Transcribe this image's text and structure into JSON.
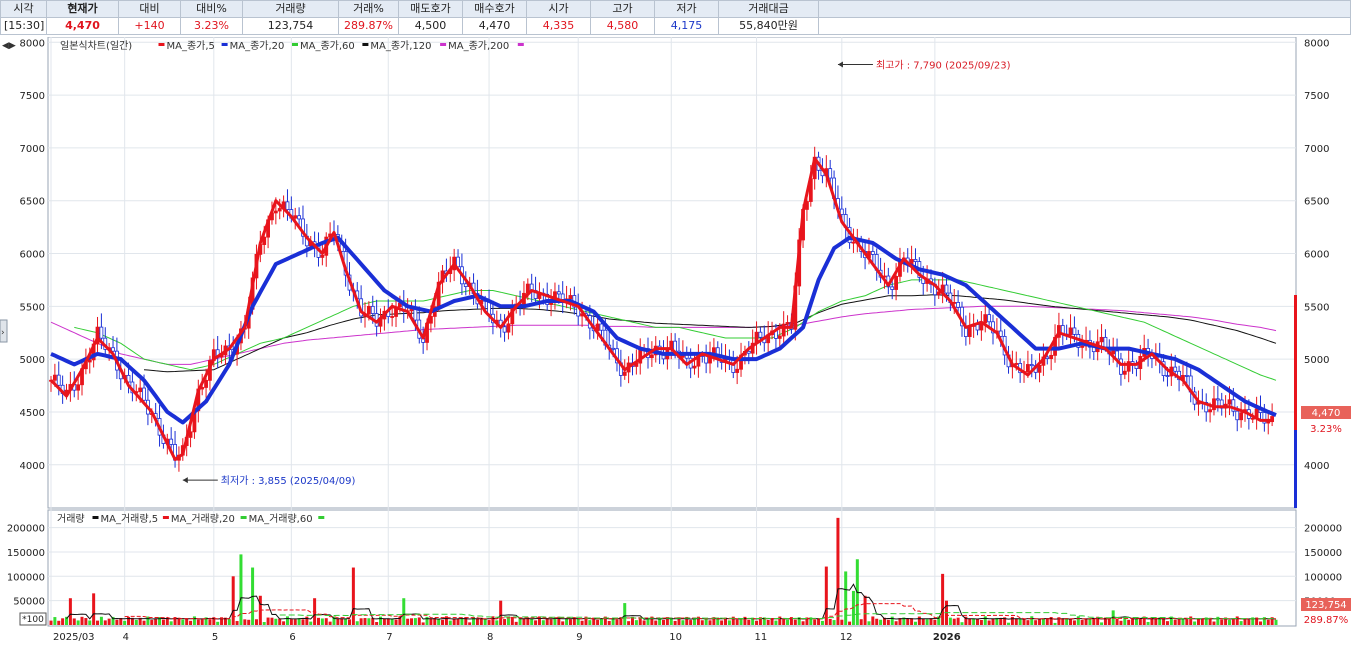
{
  "quote": {
    "headers": [
      "시각",
      "현재가",
      "대비",
      "대비%",
      "거래량",
      "거래%",
      "매도호가",
      "매수호가",
      "시가",
      "고가",
      "저가",
      "거래대금"
    ],
    "values": [
      "[15:30]",
      "4,470",
      "+140",
      "3.23%",
      "123,754",
      "289.87%",
      "4,500",
      "4,470",
      "4,335",
      "4,580",
      "4,175",
      "55,840만원"
    ]
  },
  "chart_data": [
    {
      "type": "candlestick",
      "title": "일본식차트(일간)",
      "legend": [
        {
          "label": "MA_종가,5",
          "color": "#e8141c"
        },
        {
          "label": "MA_종가,20",
          "color": "#1a2fd6"
        },
        {
          "label": "MA_종가,60",
          "color": "#33cc33"
        },
        {
          "label": "MA_종가,120",
          "color": "#111111"
        },
        {
          "label": "MA_종가,200",
          "color": "#cc33cc"
        }
      ],
      "ylim": [
        3600,
        8050
      ],
      "y_ticks": [
        "8000",
        "7500",
        "7000",
        "6500",
        "6000",
        "5500",
        "5000",
        "4500",
        "4000"
      ],
      "x_ticks": [
        "2025/03",
        "4",
        "5",
        "6",
        "7",
        "8",
        "9",
        "10",
        "11",
        "12",
        "2026"
      ],
      "annotations": [
        {
          "label": "최고가 : 7,790 (2025/09/23)",
          "value": 7790
        },
        {
          "label": "최저가 : 3,855 (2025/04/09)",
          "value": 3855
        }
      ],
      "current_label": "4,470",
      "current_pct": "3.23%",
      "ma5_anchors": [
        [
          0,
          4800
        ],
        [
          4,
          4650
        ],
        [
          8,
          4900
        ],
        [
          12,
          5200
        ],
        [
          16,
          5050
        ],
        [
          20,
          4750
        ],
        [
          26,
          4500
        ],
        [
          30,
          4200
        ],
        [
          32,
          4050
        ],
        [
          34,
          4100
        ],
        [
          38,
          4700
        ],
        [
          42,
          5000
        ],
        [
          46,
          5100
        ],
        [
          50,
          5300
        ],
        [
          54,
          6100
        ],
        [
          58,
          6500
        ],
        [
          62,
          6350
        ],
        [
          66,
          6150
        ],
        [
          70,
          6000
        ],
        [
          73,
          6200
        ],
        [
          76,
          5850
        ],
        [
          80,
          5450
        ],
        [
          84,
          5350
        ],
        [
          88,
          5500
        ],
        [
          92,
          5450
        ],
        [
          96,
          5200
        ],
        [
          100,
          5700
        ],
        [
          104,
          5900
        ],
        [
          108,
          5700
        ],
        [
          112,
          5450
        ],
        [
          116,
          5300
        ],
        [
          120,
          5500
        ],
        [
          124,
          5650
        ],
        [
          128,
          5600
        ],
        [
          132,
          5550
        ],
        [
          136,
          5500
        ],
        [
          140,
          5300
        ],
        [
          144,
          5100
        ],
        [
          148,
          4900
        ],
        [
          152,
          5000
        ],
        [
          156,
          5100
        ],
        [
          160,
          5100
        ],
        [
          164,
          4950
        ],
        [
          168,
          5050
        ],
        [
          172,
          5000
        ],
        [
          176,
          4950
        ],
        [
          180,
          5100
        ],
        [
          184,
          5200
        ],
        [
          188,
          5300
        ],
        [
          191,
          5300
        ],
        [
          194,
          6400
        ],
        [
          197,
          6900
        ],
        [
          200,
          6750
        ],
        [
          204,
          6300
        ],
        [
          208,
          6100
        ],
        [
          212,
          5900
        ],
        [
          216,
          5700
        ],
        [
          220,
          5950
        ],
        [
          224,
          5800
        ],
        [
          228,
          5700
        ],
        [
          232,
          5550
        ],
        [
          236,
          5300
        ],
        [
          240,
          5350
        ],
        [
          244,
          5250
        ],
        [
          248,
          4950
        ],
        [
          252,
          4850
        ],
        [
          256,
          5000
        ],
        [
          260,
          5250
        ],
        [
          264,
          5200
        ],
        [
          268,
          5150
        ],
        [
          272,
          5100
        ],
        [
          276,
          4950
        ],
        [
          280,
          4950
        ],
        [
          284,
          5050
        ],
        [
          288,
          4900
        ],
        [
          292,
          4800
        ],
        [
          296,
          4600
        ],
        [
          300,
          4550
        ],
        [
          304,
          4550
        ],
        [
          308,
          4500
        ],
        [
          312,
          4420
        ],
        [
          315,
          4420
        ]
      ],
      "ma20_anchors": [
        [
          0,
          5050
        ],
        [
          6,
          4950
        ],
        [
          12,
          5050
        ],
        [
          18,
          5000
        ],
        [
          24,
          4800
        ],
        [
          30,
          4500
        ],
        [
          34,
          4400
        ],
        [
          40,
          4600
        ],
        [
          46,
          4950
        ],
        [
          52,
          5500
        ],
        [
          58,
          5900
        ],
        [
          64,
          6000
        ],
        [
          70,
          6100
        ],
        [
          74,
          6150
        ],
        [
          80,
          5900
        ],
        [
          86,
          5650
        ],
        [
          92,
          5500
        ],
        [
          98,
          5450
        ],
        [
          104,
          5550
        ],
        [
          110,
          5600
        ],
        [
          116,
          5500
        ],
        [
          122,
          5500
        ],
        [
          128,
          5550
        ],
        [
          134,
          5550
        ],
        [
          140,
          5450
        ],
        [
          146,
          5200
        ],
        [
          152,
          5100
        ],
        [
          158,
          5050
        ],
        [
          164,
          5050
        ],
        [
          170,
          5050
        ],
        [
          176,
          5000
        ],
        [
          182,
          5000
        ],
        [
          188,
          5100
        ],
        [
          194,
          5300
        ],
        [
          198,
          5750
        ],
        [
          202,
          6050
        ],
        [
          206,
          6150
        ],
        [
          212,
          6100
        ],
        [
          218,
          5950
        ],
        [
          224,
          5850
        ],
        [
          230,
          5800
        ],
        [
          236,
          5700
        ],
        [
          242,
          5500
        ],
        [
          248,
          5300
        ],
        [
          254,
          5100
        ],
        [
          260,
          5100
        ],
        [
          266,
          5150
        ],
        [
          272,
          5100
        ],
        [
          278,
          5100
        ],
        [
          284,
          5050
        ],
        [
          290,
          5000
        ],
        [
          296,
          4900
        ],
        [
          302,
          4750
        ],
        [
          308,
          4600
        ],
        [
          314,
          4500
        ],
        [
          316,
          4470
        ]
      ],
      "ma60_anchors": [
        [
          6,
          5300
        ],
        [
          12,
          5250
        ],
        [
          18,
          5150
        ],
        [
          24,
          5000
        ],
        [
          30,
          4950
        ],
        [
          36,
          4900
        ],
        [
          42,
          4950
        ],
        [
          48,
          5050
        ],
        [
          54,
          5150
        ],
        [
          60,
          5200
        ],
        [
          66,
          5300
        ],
        [
          72,
          5400
        ],
        [
          78,
          5500
        ],
        [
          84,
          5550
        ],
        [
          90,
          5550
        ],
        [
          96,
          5550
        ],
        [
          102,
          5600
        ],
        [
          108,
          5650
        ],
        [
          114,
          5650
        ],
        [
          120,
          5600
        ],
        [
          126,
          5550
        ],
        [
          132,
          5500
        ],
        [
          138,
          5450
        ],
        [
          144,
          5400
        ],
        [
          150,
          5350
        ],
        [
          156,
          5300
        ],
        [
          162,
          5300
        ],
        [
          168,
          5250
        ],
        [
          174,
          5200
        ],
        [
          180,
          5200
        ],
        [
          186,
          5200
        ],
        [
          192,
          5300
        ],
        [
          198,
          5450
        ],
        [
          204,
          5550
        ],
        [
          210,
          5600
        ],
        [
          216,
          5700
        ],
        [
          222,
          5750
        ],
        [
          228,
          5750
        ],
        [
          234,
          5750
        ],
        [
          240,
          5700
        ],
        [
          246,
          5650
        ],
        [
          252,
          5600
        ],
        [
          258,
          5550
        ],
        [
          264,
          5500
        ],
        [
          270,
          5450
        ],
        [
          276,
          5400
        ],
        [
          282,
          5350
        ],
        [
          288,
          5250
        ],
        [
          294,
          5150
        ],
        [
          300,
          5050
        ],
        [
          306,
          4950
        ],
        [
          312,
          4850
        ],
        [
          316,
          4800
        ]
      ],
      "ma120_anchors": [
        [
          24,
          4900
        ],
        [
          30,
          4880
        ],
        [
          36,
          4890
        ],
        [
          42,
          4900
        ],
        [
          48,
          5000
        ],
        [
          54,
          5100
        ],
        [
          60,
          5200
        ],
        [
          66,
          5250
        ],
        [
          72,
          5320
        ],
        [
          78,
          5380
        ],
        [
          84,
          5420
        ],
        [
          90,
          5430
        ],
        [
          96,
          5440
        ],
        [
          102,
          5460
        ],
        [
          108,
          5470
        ],
        [
          114,
          5480
        ],
        [
          120,
          5480
        ],
        [
          126,
          5470
        ],
        [
          132,
          5450
        ],
        [
          138,
          5420
        ],
        [
          144,
          5380
        ],
        [
          150,
          5360
        ],
        [
          156,
          5340
        ],
        [
          162,
          5330
        ],
        [
          168,
          5320
        ],
        [
          174,
          5310
        ],
        [
          180,
          5300
        ],
        [
          186,
          5310
        ],
        [
          192,
          5340
        ],
        [
          198,
          5440
        ],
        [
          204,
          5520
        ],
        [
          210,
          5560
        ],
        [
          216,
          5600
        ],
        [
          222,
          5600
        ],
        [
          228,
          5610
        ],
        [
          234,
          5600
        ],
        [
          240,
          5580
        ],
        [
          246,
          5560
        ],
        [
          252,
          5530
        ],
        [
          258,
          5500
        ],
        [
          264,
          5480
        ],
        [
          270,
          5460
        ],
        [
          276,
          5440
        ],
        [
          282,
          5420
        ],
        [
          288,
          5400
        ],
        [
          294,
          5370
        ],
        [
          300,
          5320
        ],
        [
          306,
          5270
        ],
        [
          312,
          5200
        ],
        [
          316,
          5150
        ]
      ],
      "ma200_anchors": [
        [
          0,
          5350
        ],
        [
          6,
          5250
        ],
        [
          12,
          5150
        ],
        [
          18,
          5050
        ],
        [
          24,
          5000
        ],
        [
          30,
          4950
        ],
        [
          36,
          4950
        ],
        [
          42,
          5000
        ],
        [
          48,
          5050
        ],
        [
          54,
          5100
        ],
        [
          60,
          5150
        ],
        [
          66,
          5180
        ],
        [
          72,
          5200
        ],
        [
          78,
          5220
        ],
        [
          84,
          5240
        ],
        [
          90,
          5260
        ],
        [
          96,
          5280
        ],
        [
          102,
          5290
        ],
        [
          108,
          5300
        ],
        [
          114,
          5310
        ],
        [
          120,
          5320
        ],
        [
          126,
          5320
        ],
        [
          132,
          5320
        ],
        [
          138,
          5320
        ],
        [
          144,
          5310
        ],
        [
          150,
          5310
        ],
        [
          156,
          5300
        ],
        [
          162,
          5300
        ],
        [
          168,
          5300
        ],
        [
          174,
          5300
        ],
        [
          180,
          5300
        ],
        [
          186,
          5310
        ],
        [
          192,
          5320
        ],
        [
          198,
          5360
        ],
        [
          204,
          5400
        ],
        [
          210,
          5430
        ],
        [
          216,
          5450
        ],
        [
          222,
          5470
        ],
        [
          228,
          5480
        ],
        [
          234,
          5490
        ],
        [
          240,
          5500
        ],
        [
          246,
          5500
        ],
        [
          252,
          5500
        ],
        [
          258,
          5490
        ],
        [
          264,
          5480
        ],
        [
          270,
          5470
        ],
        [
          276,
          5460
        ],
        [
          282,
          5440
        ],
        [
          288,
          5420
        ],
        [
          294,
          5400
        ],
        [
          300,
          5370
        ],
        [
          306,
          5330
        ],
        [
          312,
          5300
        ],
        [
          316,
          5270
        ]
      ]
    },
    {
      "type": "bar",
      "title": "거래량",
      "legend": [
        {
          "label": "MA_거래량,5",
          "color": "#111111"
        },
        {
          "label": "MA_거래량,20",
          "color": "#e8141c"
        },
        {
          "label": "MA_거래량,60",
          "color": "#33cc33"
        }
      ],
      "ylim": [
        0,
        230000
      ],
      "y_ticks": [
        "200000",
        "150000",
        "100000",
        "50000"
      ],
      "unit_label": "*100",
      "current_label": "123,754",
      "current_pct": "289.87%",
      "spikes": [
        [
          5,
          55000
        ],
        [
          11,
          65000
        ],
        [
          47,
          100000
        ],
        [
          49,
          145000
        ],
        [
          52,
          118000
        ],
        [
          54,
          60000
        ],
        [
          68,
          55000
        ],
        [
          78,
          118000
        ],
        [
          91,
          55000
        ],
        [
          116,
          50000
        ],
        [
          148,
          45000
        ],
        [
          200,
          120000
        ],
        [
          203,
          220000
        ],
        [
          205,
          110000
        ],
        [
          207,
          70000
        ],
        [
          208,
          135000
        ],
        [
          210,
          60000
        ],
        [
          230,
          105000
        ],
        [
          231,
          50000
        ],
        [
          274,
          30000
        ]
      ]
    }
  ]
}
